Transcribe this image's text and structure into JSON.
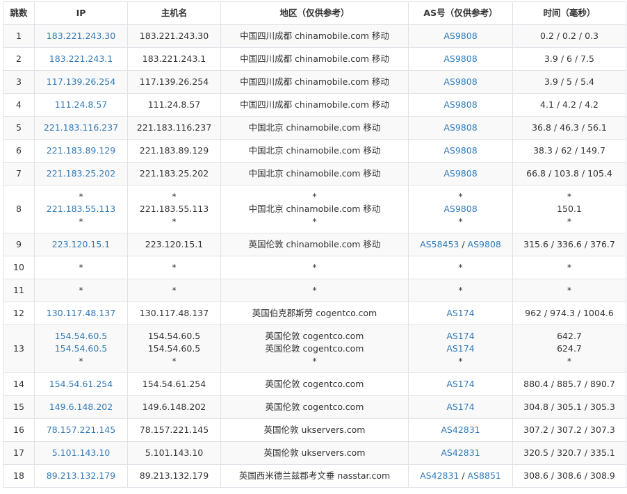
{
  "headers": {
    "hop": "跳数",
    "ip": "IP",
    "host": "主机名",
    "region": "地区（仅供参考）",
    "asn": "AS号（仅供参考）",
    "time": "时间（毫秒）"
  },
  "rows": [
    {
      "hop": "1",
      "ip": [
        "183.221.243.30"
      ],
      "host": [
        "183.221.243.30"
      ],
      "region": [
        "中国四川成都 chinamobile.com 移动"
      ],
      "asn": [
        [
          "AS9808"
        ]
      ],
      "time": [
        "0.2 / 0.2 / 0.3"
      ]
    },
    {
      "hop": "2",
      "ip": [
        "183.221.243.1"
      ],
      "host": [
        "183.221.243.1"
      ],
      "region": [
        "中国四川成都 chinamobile.com 移动"
      ],
      "asn": [
        [
          "AS9808"
        ]
      ],
      "time": [
        "3.9 / 6 / 7.5"
      ]
    },
    {
      "hop": "3",
      "ip": [
        "117.139.26.254"
      ],
      "host": [
        "117.139.26.254"
      ],
      "region": [
        "中国四川成都 chinamobile.com 移动"
      ],
      "asn": [
        [
          "AS9808"
        ]
      ],
      "time": [
        "3.9 / 5 / 5.4"
      ]
    },
    {
      "hop": "4",
      "ip": [
        "111.24.8.57"
      ],
      "host": [
        "111.24.8.57"
      ],
      "region": [
        "中国四川成都 chinamobile.com 移动"
      ],
      "asn": [
        [
          "AS9808"
        ]
      ],
      "time": [
        "4.1 / 4.2 / 4.2"
      ]
    },
    {
      "hop": "5",
      "ip": [
        "221.183.116.237"
      ],
      "host": [
        "221.183.116.237"
      ],
      "region": [
        "中国北京 chinamobile.com 移动"
      ],
      "asn": [
        [
          "AS9808"
        ]
      ],
      "time": [
        "36.8 / 46.3 / 56.1"
      ]
    },
    {
      "hop": "6",
      "ip": [
        "221.183.89.129"
      ],
      "host": [
        "221.183.89.129"
      ],
      "region": [
        "中国北京 chinamobile.com 移动"
      ],
      "asn": [
        [
          "AS9808"
        ]
      ],
      "time": [
        "38.3 / 62 / 149.7"
      ]
    },
    {
      "hop": "7",
      "ip": [
        "221.183.25.202"
      ],
      "host": [
        "221.183.25.202"
      ],
      "region": [
        "中国北京 chinamobile.com 移动"
      ],
      "asn": [
        [
          "AS9808"
        ]
      ],
      "time": [
        "66.8 / 103.8 / 105.4"
      ]
    },
    {
      "hop": "8",
      "ip": [
        "*",
        "221.183.55.113",
        "*"
      ],
      "host": [
        "*",
        "221.183.55.113",
        "*"
      ],
      "region": [
        "*",
        "中国北京 chinamobile.com 移动",
        "*"
      ],
      "asn": [
        [
          "*"
        ],
        [
          "AS9808"
        ],
        [
          "*"
        ]
      ],
      "time": [
        "*",
        "150.1",
        "*"
      ]
    },
    {
      "hop": "9",
      "ip": [
        "223.120.15.1"
      ],
      "host": [
        "223.120.15.1"
      ],
      "region": [
        "英国伦敦 chinamobile.com 移动"
      ],
      "asn": [
        [
          "AS58453",
          "AS9808"
        ]
      ],
      "time": [
        "315.6 / 336.6 / 376.7"
      ]
    },
    {
      "hop": "10",
      "ip": [
        "*"
      ],
      "host": [
        "*"
      ],
      "region": [
        "*"
      ],
      "asn": [
        [
          "*"
        ]
      ],
      "time": [
        "*"
      ]
    },
    {
      "hop": "11",
      "ip": [
        "*"
      ],
      "host": [
        "*"
      ],
      "region": [
        "*"
      ],
      "asn": [
        [
          "*"
        ]
      ],
      "time": [
        "*"
      ]
    },
    {
      "hop": "12",
      "ip": [
        "130.117.48.137"
      ],
      "host": [
        "130.117.48.137"
      ],
      "region": [
        "英国伯克郡斯劳 cogentco.com"
      ],
      "asn": [
        [
          "AS174"
        ]
      ],
      "time": [
        "962 / 974.3 / 1004.6"
      ]
    },
    {
      "hop": "13",
      "ip": [
        "154.54.60.5",
        "154.54.60.5",
        "*"
      ],
      "host": [
        "154.54.60.5",
        "154.54.60.5",
        "*"
      ],
      "region": [
        "英国伦敦 cogentco.com",
        "英国伦敦 cogentco.com",
        "*"
      ],
      "asn": [
        [
          "AS174"
        ],
        [
          "AS174"
        ],
        [
          "*"
        ]
      ],
      "time": [
        "642.7",
        "624.7",
        "*"
      ]
    },
    {
      "hop": "14",
      "ip": [
        "154.54.61.254"
      ],
      "host": [
        "154.54.61.254"
      ],
      "region": [
        "英国伦敦 cogentco.com"
      ],
      "asn": [
        [
          "AS174"
        ]
      ],
      "time": [
        "880.4 / 885.7 / 890.7"
      ]
    },
    {
      "hop": "15",
      "ip": [
        "149.6.148.202"
      ],
      "host": [
        "149.6.148.202"
      ],
      "region": [
        "英国伦敦 cogentco.com"
      ],
      "asn": [
        [
          "AS174"
        ]
      ],
      "time": [
        "304.8 / 305.1 / 305.3"
      ]
    },
    {
      "hop": "16",
      "ip": [
        "78.157.221.145"
      ],
      "host": [
        "78.157.221.145"
      ],
      "region": [
        "英国伦敦 ukservers.com"
      ],
      "asn": [
        [
          "AS42831"
        ]
      ],
      "time": [
        "307.2 / 307.2 / 307.3"
      ]
    },
    {
      "hop": "17",
      "ip": [
        "5.101.143.10"
      ],
      "host": [
        "5.101.143.10"
      ],
      "region": [
        "英国伦敦 ukservers.com"
      ],
      "asn": [
        [
          "AS42831"
        ]
      ],
      "time": [
        "320.5 / 320.7 / 335.1"
      ]
    },
    {
      "hop": "18",
      "ip": [
        "89.213.132.179"
      ],
      "host": [
        "89.213.132.179"
      ],
      "region": [
        "英国西米德兰兹郡考文垂 nasstar.com"
      ],
      "asn": [
        [
          "AS42831",
          "AS8851"
        ]
      ],
      "time": [
        "308.6 / 308.6 / 308.9"
      ]
    }
  ],
  "colors": {
    "link": "#337ab7",
    "text": "#333333",
    "border": "#dfe3e8",
    "row_stripe": "#f9f9f9"
  }
}
